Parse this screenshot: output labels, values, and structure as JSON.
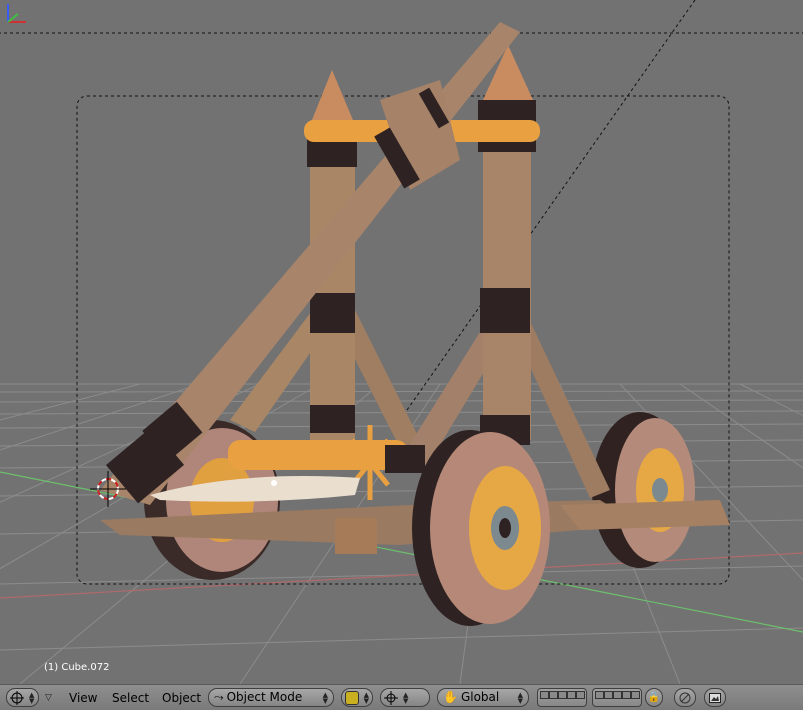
{
  "viewport": {
    "object_label": "(1) Cube.072",
    "colors": {
      "background": "#727272",
      "grid": "#8a8a8a",
      "x_axis": "#c87070",
      "y_axis": "#6cc06c",
      "wood": "#a98768",
      "metal": "#2e2222",
      "axle": "#e8a040"
    }
  },
  "header": {
    "editor_icon": "cursor-cross-icon",
    "menus": {
      "view": "View",
      "select": "Select",
      "object": "Object"
    },
    "mode": "Object Mode",
    "orientation": "Global"
  }
}
